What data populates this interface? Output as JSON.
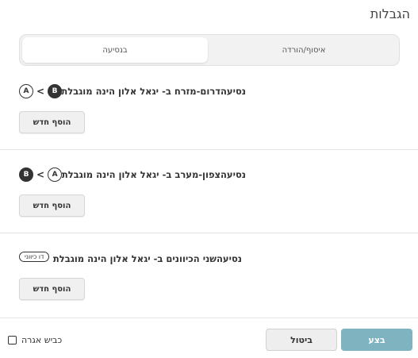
{
  "dialog": {
    "title": "הגבלות"
  },
  "tabs": {
    "active_label": "בנסיעה",
    "inactive_label": "איסוף/הורדה"
  },
  "restrictions": [
    {
      "text": "נסיעהדרום-מזרח ב- יגאל אלון הינה מוגבלת",
      "from": "B",
      "arrow": "<",
      "to": "A",
      "add_label": "הוסף חדש"
    },
    {
      "text": "נסיעהצפון-מערב ב- יגאל אלון הינה מוגבלת",
      "from": "A",
      "arrow": "<",
      "to": "B",
      "add_label": "הוסף חדש"
    },
    {
      "text": "נסיעהשני הכיוונים ב- יגאל אלון הינה מוגבלת",
      "pill": "דו כיווני",
      "add_label": "הוסף חדש"
    }
  ],
  "footer": {
    "execute_label": "בצע",
    "cancel_label": "ביטול",
    "toll_label": "כביש אגרה",
    "toll_checked": false
  },
  "colors": {
    "execute_bg": "#7fb3c0",
    "badge_dark": "#333333"
  }
}
